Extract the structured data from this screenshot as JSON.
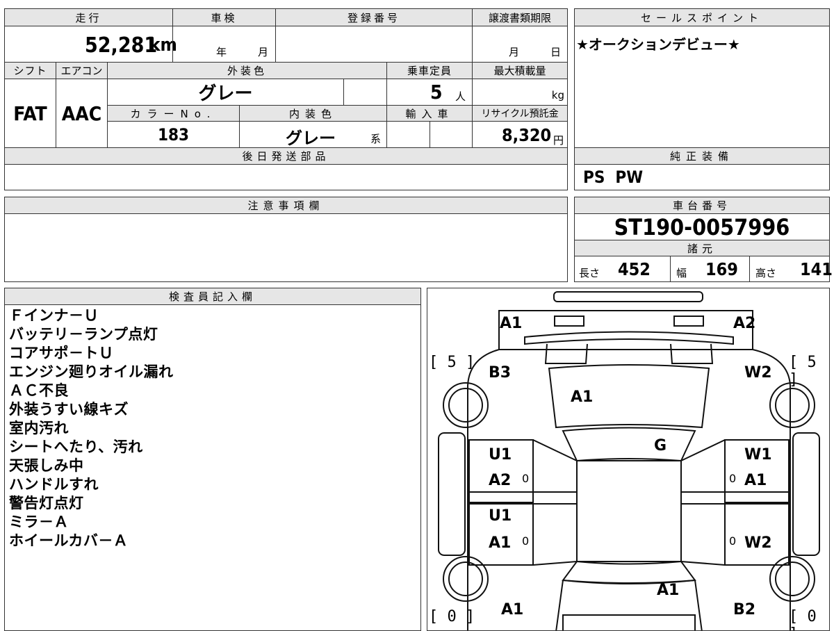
{
  "basic": {
    "mileage_label": "走行",
    "mileage_value": "52,281",
    "mileage_unit": "km",
    "inspection_label": "車検",
    "inspection_year_unit": "年",
    "inspection_month_unit": "月",
    "registration_label": "登録番号",
    "registration_value": "",
    "transfer_label": "譲渡書類期限",
    "transfer_month_unit": "月",
    "transfer_day_unit": "日"
  },
  "spec": {
    "shift_label": "シフト",
    "shift_value": "FAT",
    "aircon_label": "エアコン",
    "aircon_value": "AAC",
    "exterior_color_label": "外装色",
    "exterior_color_value": "グレー",
    "capacity_label": "乗車定員",
    "capacity_value": "5",
    "capacity_unit": "人",
    "max_load_label": "最大積載量",
    "max_load_unit": "kg",
    "color_no_label": "カラーNo.",
    "color_no_value": "183",
    "interior_color_label": "内装色",
    "interior_color_value": "グレー",
    "interior_color_suffix": "系",
    "import_label": "輸入車",
    "recycle_label": "リサイクル預託金",
    "recycle_value": "8,320",
    "recycle_unit": "円",
    "deferred_label": "後日発送部品"
  },
  "sales": {
    "label": "セールスポイント",
    "value": "★オークションデビュー★"
  },
  "equipment": {
    "label": "純正装備",
    "value": "PS  PW"
  },
  "caution": {
    "label": "注意事項欄"
  },
  "chassis": {
    "label": "車台番号",
    "value": "ST190-0057996",
    "dims_label": "諸元",
    "length_label": "長さ",
    "length_value": "452",
    "width_label": "幅",
    "width_value": "169",
    "height_label": "高さ",
    "height_value": "141"
  },
  "inspector": {
    "label": "検査員記入欄",
    "notes": [
      "Ｆインナ－Ｕ",
      "バッテリ－ランプ点灯",
      "コアサポ－トＵ",
      "エンジン廻りオイル漏れ",
      "ＡＣ不良",
      "外装うすい線キズ",
      "室内汚れ",
      "シートへたり、汚れ",
      "天張しみ中",
      "ハンドルすれ",
      "警告灯点灯",
      "ミラ－Ａ",
      "ホイールカバ－Ａ"
    ]
  },
  "diagram": {
    "tread_front_left": "[ 5 ]",
    "tread_front_right": "[ 5 ]",
    "tread_rear_left": "[ 0 ]",
    "tread_rear_right": "[ 0 ]",
    "marks": {
      "front_bumper_left": "A1",
      "front_bumper_right": "A2",
      "front_left_fender": "B3",
      "front_right_fender": "W2",
      "hood": "A1",
      "windshield": "G",
      "left_front_door_1": "U1",
      "left_front_door_2": "A2",
      "right_front_door_1": "W1",
      "right_front_door_2": "A1",
      "left_rear_door_1": "U1",
      "left_rear_door_2": "A1",
      "right_rear_door": "W2",
      "trunk": "A1",
      "rear_left": "A1",
      "rear_right": "B2",
      "tick_lf": "0",
      "tick_rf": "0",
      "tick_lr": "0",
      "tick_rr": "0"
    }
  }
}
